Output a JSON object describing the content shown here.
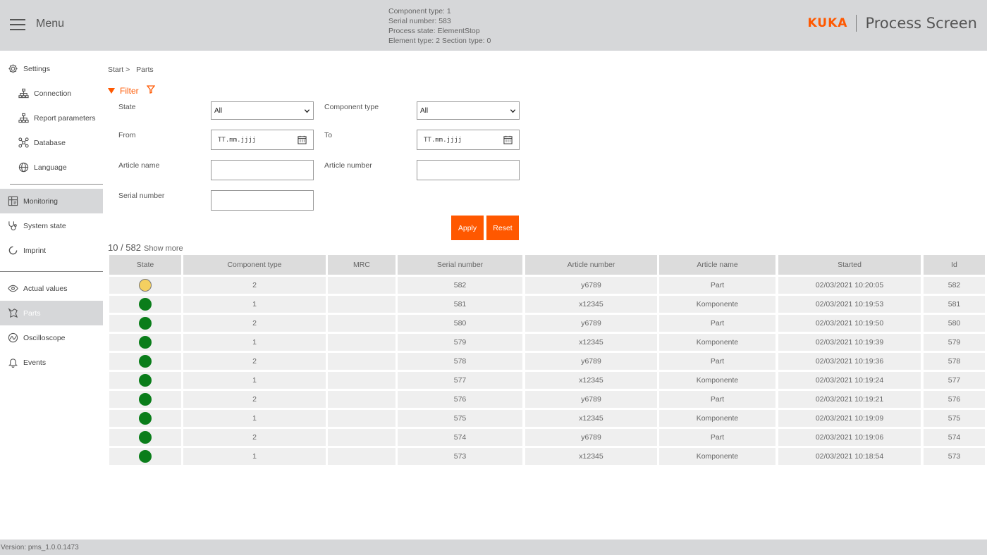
{
  "header": {
    "menu_label": "Menu",
    "status_lines": [
      "Component type: 1",
      "Serial number: 583",
      "Process state: ElementStop",
      "Element type: 2 Section type: 0"
    ],
    "logo_text": "KUKA",
    "app_title": "Process Screen",
    "accent_color": "#ff5800"
  },
  "sidebar": {
    "settings": "Settings",
    "connection": "Connection",
    "report_parameters": "Report parameters",
    "database": "Database",
    "language": "Language",
    "monitoring": "Monitoring",
    "system_state": "System state",
    "imprint": "Imprint",
    "actual_values": "Actual values",
    "parts": "Parts",
    "oscilloscope": "Oscilloscope",
    "events": "Events"
  },
  "breadcrumb": {
    "start": "Start >",
    "current": "Parts"
  },
  "filter": {
    "toggle_label": "Filter",
    "state_label": "State",
    "state_value": "All",
    "component_type_label": "Component type",
    "component_type_value": "All",
    "from_label": "From",
    "from_placeholder": "TT.mm.jjjj",
    "to_label": "To",
    "to_placeholder": "TT.mm.jjjj",
    "article_name_label": "Article name",
    "article_name_value": "",
    "article_number_label": "Article number",
    "article_number_value": "",
    "serial_number_label": "Serial number",
    "serial_number_value": "",
    "apply_label": "Apply",
    "reset_label": "Reset"
  },
  "results": {
    "count_text": "10 / 582",
    "show_more": "Show more"
  },
  "table": {
    "columns": [
      "State",
      "Component type",
      "MRC",
      "Serial number",
      "Article number",
      "Article name",
      "Started",
      "Id"
    ],
    "state_colors": {
      "yellow": "#f5d060",
      "green": "#0a7d1a"
    },
    "rows": [
      {
        "state": "yellow",
        "component_type": "2",
        "mrc": "",
        "serial": "582",
        "article_number": "y6789",
        "article_name": "Part",
        "started": "02/03/2021 10:20:05",
        "id": "582"
      },
      {
        "state": "green",
        "component_type": "1",
        "mrc": "",
        "serial": "581",
        "article_number": "x12345",
        "article_name": "Komponente",
        "started": "02/03/2021 10:19:53",
        "id": "581"
      },
      {
        "state": "green",
        "component_type": "2",
        "mrc": "",
        "serial": "580",
        "article_number": "y6789",
        "article_name": "Part",
        "started": "02/03/2021 10:19:50",
        "id": "580"
      },
      {
        "state": "green",
        "component_type": "1",
        "mrc": "",
        "serial": "579",
        "article_number": "x12345",
        "article_name": "Komponente",
        "started": "02/03/2021 10:19:39",
        "id": "579"
      },
      {
        "state": "green",
        "component_type": "2",
        "mrc": "",
        "serial": "578",
        "article_number": "y6789",
        "article_name": "Part",
        "started": "02/03/2021 10:19:36",
        "id": "578"
      },
      {
        "state": "green",
        "component_type": "1",
        "mrc": "",
        "serial": "577",
        "article_number": "x12345",
        "article_name": "Komponente",
        "started": "02/03/2021 10:19:24",
        "id": "577"
      },
      {
        "state": "green",
        "component_type": "2",
        "mrc": "",
        "serial": "576",
        "article_number": "y6789",
        "article_name": "Part",
        "started": "02/03/2021 10:19:21",
        "id": "576"
      },
      {
        "state": "green",
        "component_type": "1",
        "mrc": "",
        "serial": "575",
        "article_number": "x12345",
        "article_name": "Komponente",
        "started": "02/03/2021 10:19:09",
        "id": "575"
      },
      {
        "state": "green",
        "component_type": "2",
        "mrc": "",
        "serial": "574",
        "article_number": "y6789",
        "article_name": "Part",
        "started": "02/03/2021 10:19:06",
        "id": "574"
      },
      {
        "state": "green",
        "component_type": "1",
        "mrc": "",
        "serial": "573",
        "article_number": "x12345",
        "article_name": "Komponente",
        "started": "02/03/2021 10:18:54",
        "id": "573"
      }
    ]
  },
  "footer": {
    "version": "Version: pms_1.0.0.1473"
  }
}
